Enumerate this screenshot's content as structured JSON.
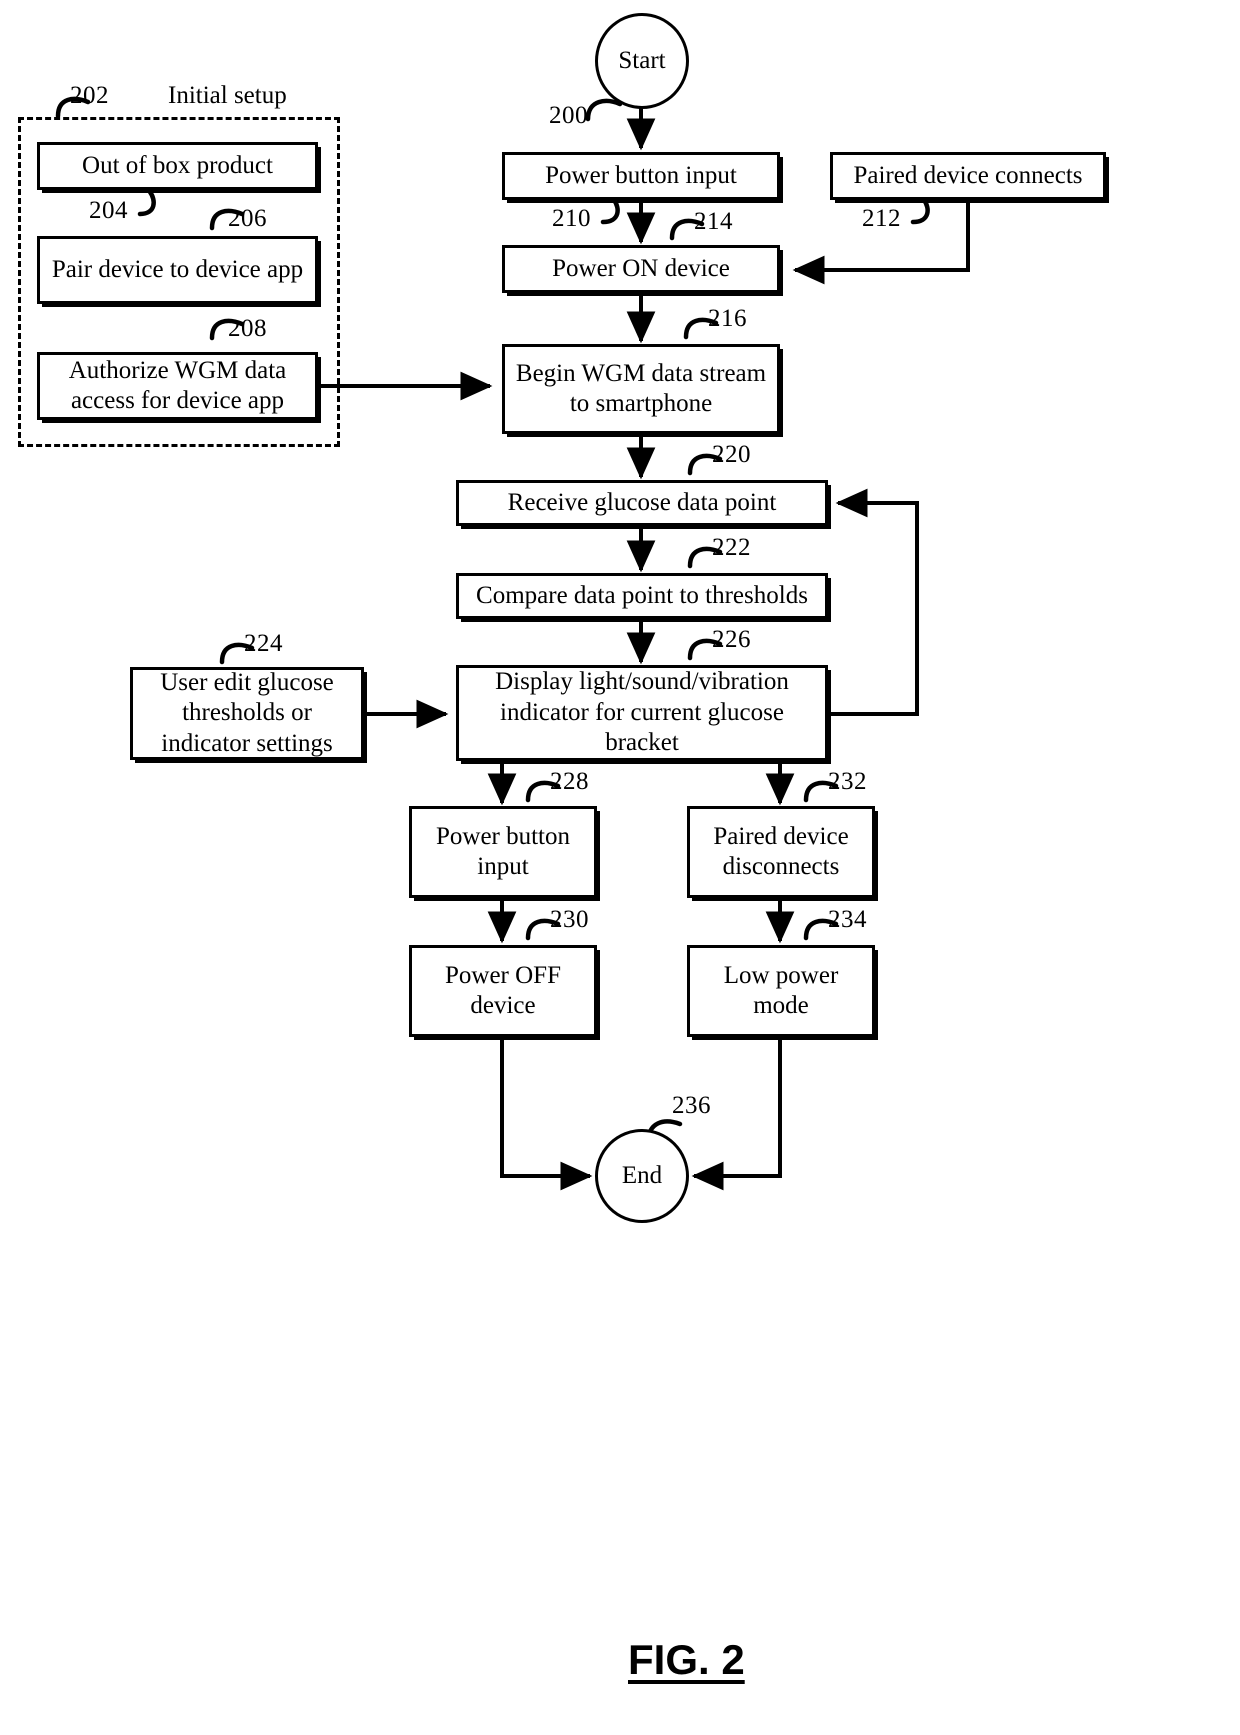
{
  "figure": {
    "caption": "FIG. 2",
    "title": "Initial setup"
  },
  "nodes": {
    "start": {
      "label": "Start",
      "ref": "200"
    },
    "out_of_box": {
      "label": "Out of box product",
      "ref": "202"
    },
    "pair_device": {
      "label": "Pair device to device app",
      "ref": "206"
    },
    "authorize_wgm": {
      "label": "Authorize WGM data access for device app",
      "ref": "208"
    },
    "power_button_input": {
      "label": "Power button input",
      "ref": "210"
    },
    "paired_device_connects": {
      "label": "Paired device connects",
      "ref": "212"
    },
    "power_on_device": {
      "label": "Power ON device",
      "ref": "214"
    },
    "begin_wgm_stream": {
      "label": "Begin WGM data stream to smartphone",
      "ref": "216"
    },
    "receive_glucose": {
      "label": "Receive glucose data point",
      "ref": "220"
    },
    "compare_thresholds": {
      "label": "Compare data point to thresholds",
      "ref": "222"
    },
    "user_edit_thresholds": {
      "label": "User edit glucose thresholds or indicator settings",
      "ref": "224"
    },
    "display_indicator": {
      "label": "Display light/sound/vibration indicator for current glucose bracket",
      "ref": "226"
    },
    "power_button_input_2": {
      "label": "Power button input",
      "ref": "228"
    },
    "power_off_device": {
      "label": "Power OFF device",
      "ref": "230"
    },
    "paired_device_disconnects": {
      "label": "Paired device disconnects",
      "ref": "232"
    },
    "low_power_mode": {
      "label": "Low power mode",
      "ref": "234"
    },
    "end": {
      "label": "End",
      "ref": "236"
    }
  },
  "refs": {
    "r200": "200",
    "r202": "202",
    "r204": "204",
    "r206": "206",
    "r208": "208",
    "r210": "210",
    "r212": "212",
    "r214": "214",
    "r216": "216",
    "r220": "220",
    "r222": "222",
    "r224": "224",
    "r226": "226",
    "r228": "228",
    "r230": "230",
    "r232": "232",
    "r234": "234",
    "r236": "236"
  },
  "colors": {
    "ink": "#000000",
    "paper": "#ffffff"
  }
}
